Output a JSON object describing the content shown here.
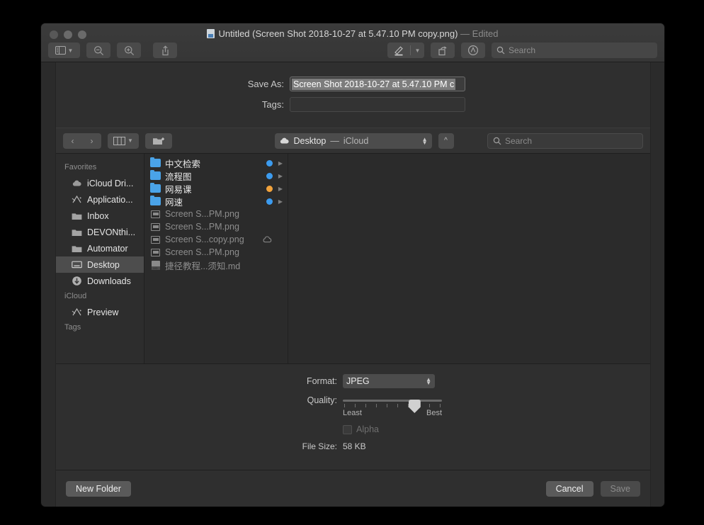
{
  "window": {
    "title_main": "Untitled (Screen Shot 2018-10-27 at 5.47.10 PM copy.png)",
    "title_state": "— Edited",
    "doc_icon": "png-document-icon",
    "traffic_lights": [
      "close-button",
      "minimize-button",
      "zoom-button"
    ]
  },
  "toolbar": {
    "left": [
      {
        "name": "sidebar-toggle-button",
        "icon": "sidebar-icon"
      },
      {
        "name": "zoom-out-button",
        "icon": "magnifier-minus-icon"
      },
      {
        "name": "zoom-in-button",
        "icon": "magnifier-plus-icon"
      },
      {
        "name": "share-button",
        "icon": "share-arrow-icon"
      }
    ],
    "right": [
      {
        "name": "markup-button",
        "icon": "marker-pen-icon"
      },
      {
        "name": "rotate-button",
        "icon": "rotate-left-icon"
      },
      {
        "name": "annotate-button",
        "icon": "signature-circle-icon"
      }
    ],
    "search": {
      "placeholder": "Search",
      "value": "",
      "icon": "search-icon"
    }
  },
  "save_sheet": {
    "save_as_label": "Save As:",
    "save_as_value": "Screen Shot 2018-10-27 at 5.47.10 PM c",
    "tags_label": "Tags:",
    "tags_value": "",
    "tags_placeholder": "",
    "nav": {
      "back_icon": "chevron-left-icon",
      "forward_icon": "chevron-right-icon",
      "view_icon": "column-view-icon",
      "view_chevron": "chevron-down-icon",
      "new_folder_icon": "new-folder-icon",
      "path_icon": "icloud-cloud-icon",
      "path_location": "Desktop",
      "path_separator": "—",
      "path_service": "iCloud",
      "up_icon": "chevron-up-icon",
      "search_placeholder": "Search",
      "search_value": ""
    },
    "sidebar": [
      {
        "type": "header",
        "label": "Favorites"
      },
      {
        "type": "item",
        "label": "iCloud Dri...",
        "icon": "icloud-drive-icon",
        "selected": false
      },
      {
        "type": "item",
        "label": "Applicatio...",
        "icon": "applications-icon",
        "selected": false
      },
      {
        "type": "item",
        "label": "Inbox",
        "icon": "folder-icon",
        "selected": false
      },
      {
        "type": "item",
        "label": "DEVONthi...",
        "icon": "folder-icon",
        "selected": false
      },
      {
        "type": "item",
        "label": "Automator",
        "icon": "folder-icon",
        "selected": false
      },
      {
        "type": "item",
        "label": "Desktop",
        "icon": "desktop-icon",
        "selected": true
      },
      {
        "type": "item",
        "label": "Downloads",
        "icon": "downloads-arrow-icon",
        "selected": false
      },
      {
        "type": "header",
        "label": "iCloud"
      },
      {
        "type": "item",
        "label": "Preview",
        "icon": "applications-icon",
        "selected": false
      },
      {
        "type": "header",
        "label": "Tags"
      }
    ],
    "files": [
      {
        "name": "中文检索",
        "kind": "folder",
        "icon": "blue-folder-icon",
        "tag_color": "#3c9bef",
        "has_disclosure": true,
        "dimmed": false,
        "cloud": false
      },
      {
        "name": "流程图",
        "kind": "folder",
        "icon": "blue-folder-icon",
        "tag_color": "#3c9bef",
        "has_disclosure": true,
        "dimmed": false,
        "cloud": false
      },
      {
        "name": "网易课",
        "kind": "folder",
        "icon": "blue-folder-icon",
        "tag_color": "#f2a33c",
        "has_disclosure": true,
        "dimmed": false,
        "cloud": false
      },
      {
        "name": "网速",
        "kind": "folder",
        "icon": "blue-folder-icon",
        "tag_color": "#3c9bef",
        "has_disclosure": true,
        "dimmed": false,
        "cloud": false
      },
      {
        "name": "Screen S...PM.png",
        "kind": "image",
        "icon": "image-file-icon",
        "tag_color": "",
        "has_disclosure": false,
        "dimmed": true,
        "cloud": false
      },
      {
        "name": "Screen S...PM.png",
        "kind": "image",
        "icon": "image-file-icon",
        "tag_color": "",
        "has_disclosure": false,
        "dimmed": true,
        "cloud": false
      },
      {
        "name": "Screen S...copy.png",
        "kind": "image",
        "icon": "image-file-icon",
        "tag_color": "",
        "has_disclosure": false,
        "dimmed": true,
        "cloud": true
      },
      {
        "name": "Screen S...PM.png",
        "kind": "image",
        "icon": "image-file-icon",
        "tag_color": "",
        "has_disclosure": false,
        "dimmed": true,
        "cloud": false
      },
      {
        "name": "捷径教程...须知.md",
        "kind": "markdown",
        "icon": "markdown-file-icon",
        "tag_color": "",
        "has_disclosure": false,
        "dimmed": true,
        "cloud": false
      }
    ],
    "options": {
      "format_label": "Format:",
      "format_value": "JPEG",
      "format_options": [
        "JPEG"
      ],
      "quality_label": "Quality:",
      "quality_percent": 72,
      "quality_least": "Least",
      "quality_best": "Best",
      "alpha_label": "Alpha",
      "alpha_checked": false,
      "alpha_enabled": false,
      "file_size_label": "File Size:",
      "file_size_value": "58 KB"
    },
    "footer": {
      "new_folder": "New Folder",
      "cancel": "Cancel",
      "save": "Save",
      "save_enabled": false
    }
  }
}
